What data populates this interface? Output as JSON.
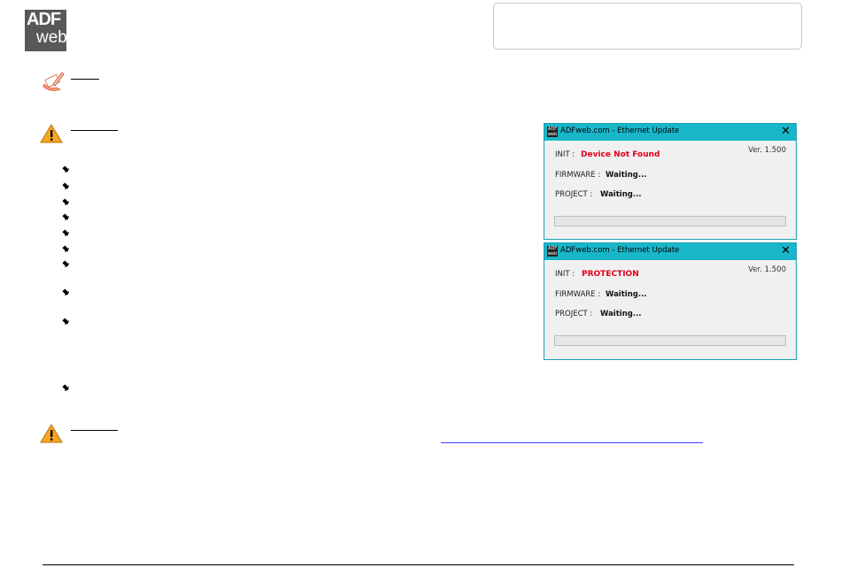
{
  "brand": {
    "logo_line1": "ADF",
    "logo_line2": "web"
  },
  "windows": [
    {
      "title": "ADFweb.com - Ethernet Update",
      "close": "✕",
      "version": "Ver. 1.500",
      "icon_text": "ADF web",
      "init_label": "INIT :",
      "init_value": "Device Not Found",
      "firmware_label": "FIRMWARE :",
      "firmware_value": "Waiting...",
      "project_label": "PROJECT :",
      "project_value": "Waiting...",
      "progress": 0
    },
    {
      "title": "ADFweb.com - Ethernet Update",
      "close": "✕",
      "version": "Ver. 1.500",
      "icon_text": "ADF web",
      "init_label": "INIT :",
      "init_value": "PROTECTION",
      "firmware_label": "FIRMWARE :",
      "firmware_value": "Waiting...",
      "project_label": "PROJECT :",
      "project_value": "Waiting...",
      "progress": 0
    }
  ],
  "colors": {
    "titlebar": "#19b6c9",
    "error": "#e0001b",
    "link": "#3b3bff",
    "logo_bg": "#58585a"
  },
  "icons": {
    "note": "note-pencil-icon",
    "warning": "warning-triangle-icon",
    "bullet": "bullet-arrow-icon"
  }
}
